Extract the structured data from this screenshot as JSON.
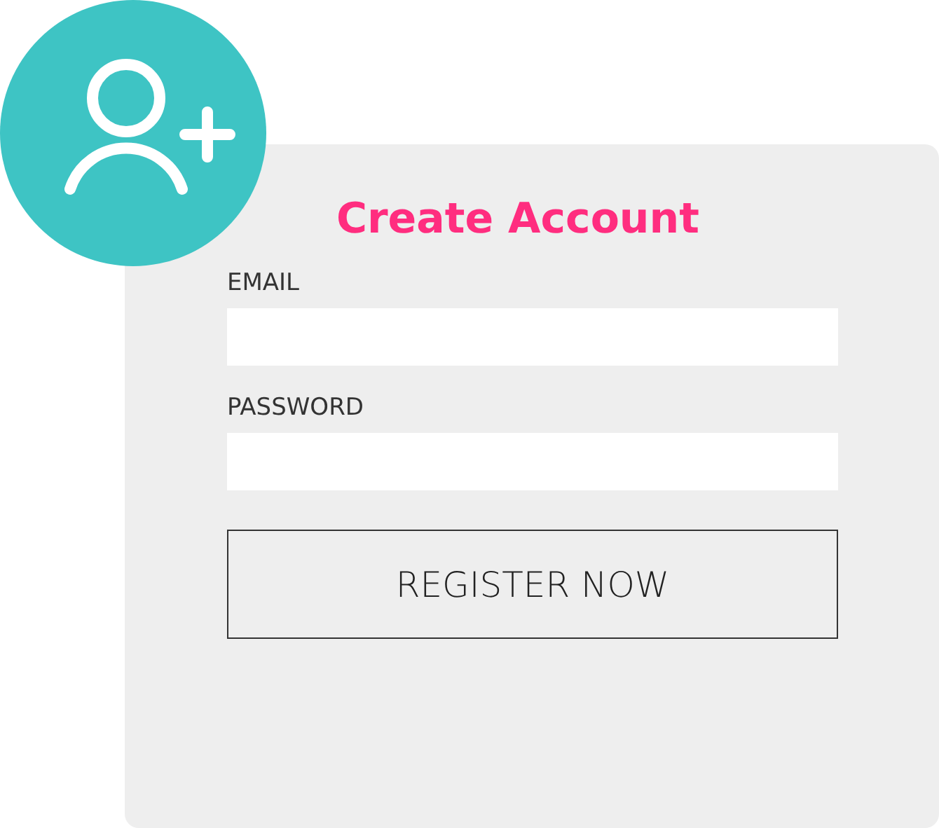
{
  "title": "Create Account",
  "fields": [
    {
      "label": "EMAIL"
    },
    {
      "label": "PASSWORD"
    }
  ],
  "button": "REGISTER NOW"
}
